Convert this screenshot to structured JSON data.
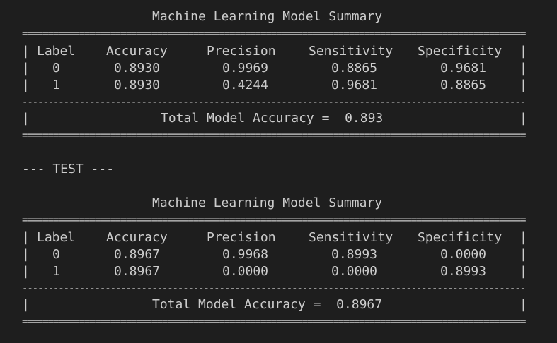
{
  "terminal": {
    "blocks": [
      {
        "title": "Machine Learning Model Summary",
        "headers": [
          "Label",
          "Accuracy",
          "Precision",
          "Sensitivity",
          "Specificity"
        ],
        "rows": [
          [
            "0",
            "0.8930",
            "0.9969",
            "0.8865",
            "0.9681"
          ],
          [
            "1",
            "0.8930",
            "0.4244",
            "0.9681",
            "0.8865"
          ]
        ],
        "total": "Total Model Accuracy =  0.893"
      },
      {
        "title": "Machine Learning Model Summary",
        "headers": [
          "Label",
          "Accuracy",
          "Precision",
          "Sensitivity",
          "Specificity"
        ],
        "rows": [
          [
            "0",
            "0.8967",
            "0.9968",
            "0.8993",
            "0.0000"
          ],
          [
            "1",
            "0.8967",
            "0.0000",
            "0.0000",
            "0.8993"
          ]
        ],
        "total": "Total Model Accuracy =  0.8967"
      }
    ],
    "separator_label": "--- TEST ---",
    "double_rule_char": "=",
    "single_rule_char": "-",
    "border_char": "|"
  }
}
